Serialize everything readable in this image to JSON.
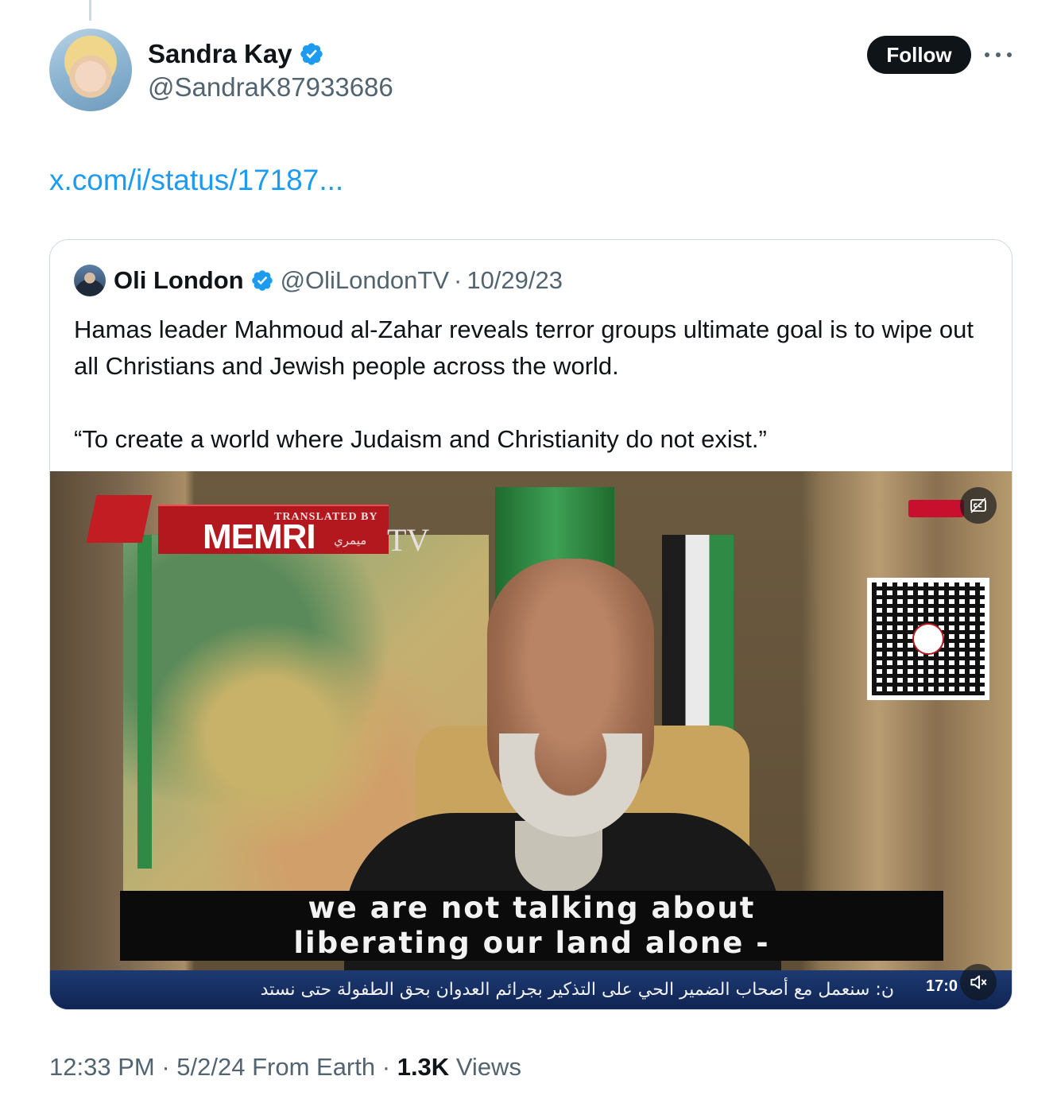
{
  "tweet": {
    "author_name": "Sandra Kay",
    "author_handle": "@SandraK87933686",
    "follow_label": "Follow",
    "link_text": "x.com/i/status/17187...",
    "meta": {
      "time": "12:33 PM",
      "separator": "·",
      "date_source": "5/2/24 From Earth",
      "views_count": "1.3K",
      "views_label": "Views"
    }
  },
  "quoted": {
    "author_name": "Oli London",
    "author_handle": "@OliLondonTV",
    "separator": "·",
    "date": "10/29/23",
    "text_paragraph_1": "Hamas leader Mahmoud al-Zahar reveals terror groups ultimate goal is to wipe out all Christians and Jewish people across the world.",
    "text_paragraph_2": "“To create a world where Judaism and Christianity do not exist.”"
  },
  "video": {
    "logo_translated_by": "TRANSLATED BY",
    "logo_name": "MEMRI",
    "logo_tv": "TV",
    "logo_arabic": "ميمري",
    "subtitle_line_1": "we are not talking about",
    "subtitle_line_2": "liberating our land alone -",
    "ticker_text": "ن: سنعمل مع أصحاب الضمير الحي على التذكير بجرائم العدوان بحق الطفولة حتى نستد",
    "ticker_clock": "17:0"
  },
  "colors": {
    "accent": "#1d9bf0",
    "text_primary": "#0f1419",
    "text_secondary": "#536471",
    "follow_bg": "#0f1419"
  },
  "icons": [
    "verified-badge-icon",
    "more-icon",
    "closed-captions-icon",
    "mute-icon"
  ]
}
